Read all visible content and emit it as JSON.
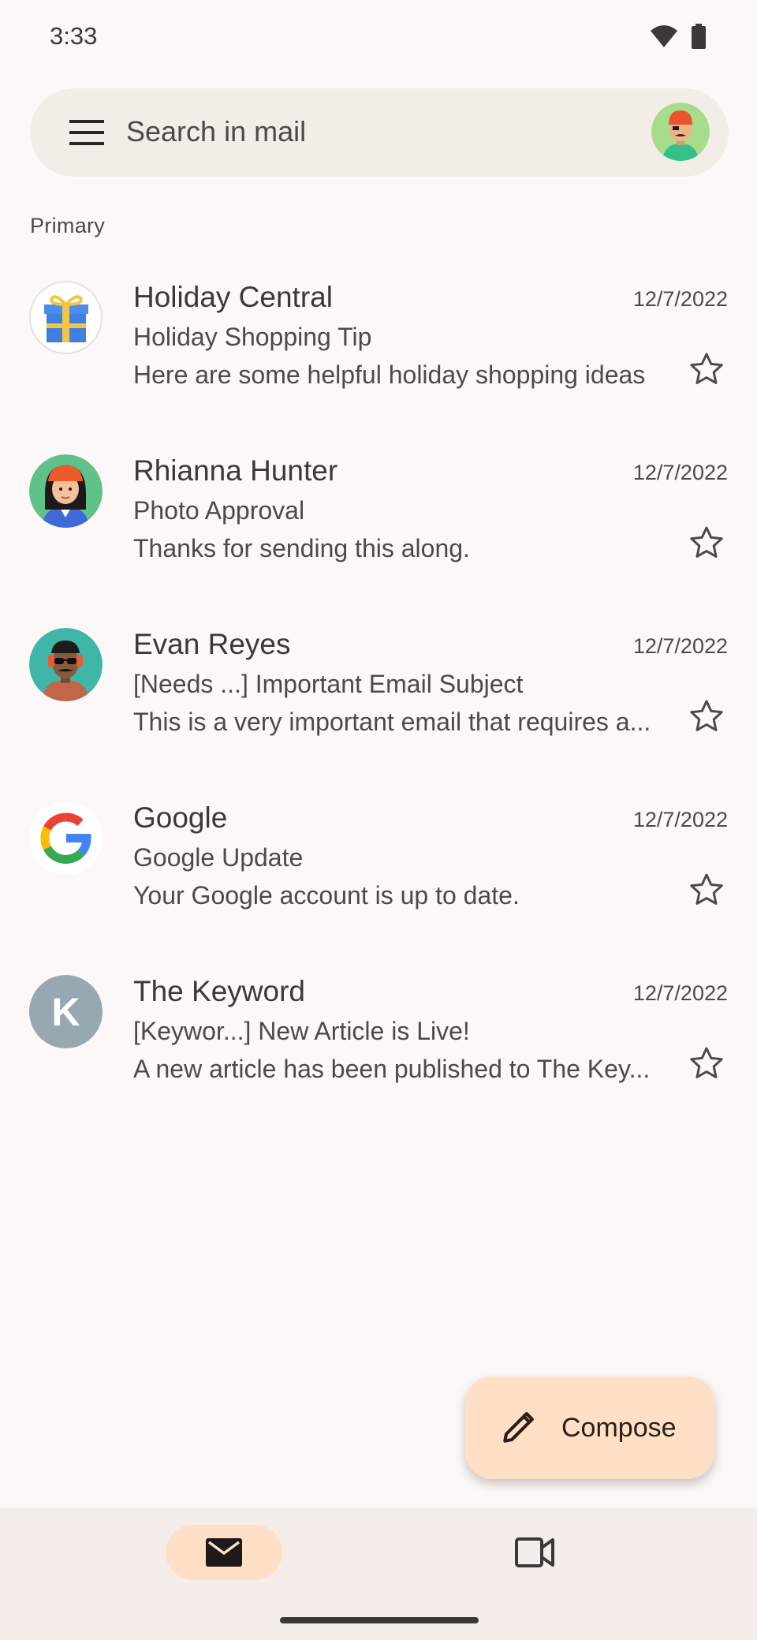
{
  "status_bar": {
    "time": "3:33"
  },
  "search": {
    "placeholder": "Search in mail"
  },
  "section": {
    "label": "Primary"
  },
  "emails": [
    {
      "sender": "Holiday Central",
      "date": "12/7/2022",
      "subject": "Holiday Shopping Tip",
      "snippet": "Here are some helpful holiday shopping ideas"
    },
    {
      "sender": "Rhianna Hunter",
      "date": "12/7/2022",
      "subject": "Photo Approval",
      "snippet": "Thanks for sending this along."
    },
    {
      "sender": "Evan Reyes",
      "date": "12/7/2022",
      "subject": "[Needs ...] Important Email Subject",
      "snippet": "This is a very important email that requires a..."
    },
    {
      "sender": "Google",
      "date": "12/7/2022",
      "subject": "Google Update",
      "snippet": "Your Google account is up to date."
    },
    {
      "sender": "The Keyword",
      "date": "12/7/2022",
      "subject": "[Keywor...] New Article is Live!",
      "snippet": "A new article has been published to The Key...",
      "avatar_letter": "K"
    }
  ],
  "compose": {
    "label": "Compose"
  },
  "colors": {
    "accent": "#ffdfc6",
    "background": "#fdf8f8",
    "search_bg": "#f3ede8"
  }
}
